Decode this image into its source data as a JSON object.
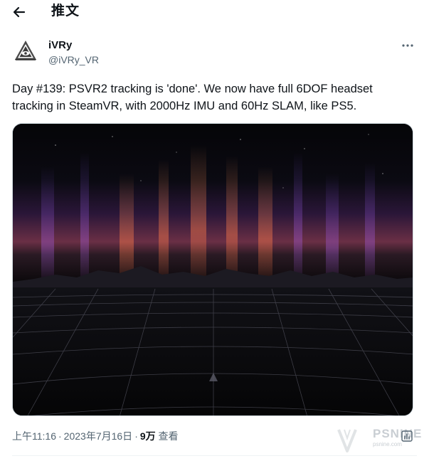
{
  "header": {
    "back_icon": "arrow-left-icon",
    "title": "推文"
  },
  "tweet": {
    "author": {
      "display_name": "iVRy",
      "handle": "@iVRy_VR",
      "avatar_icon": "triangle-eye-logo"
    },
    "more_icon": "more-dots-icon",
    "text": "Day #139: PSVR2 tracking is 'done'. We now have full 6DOF headset tracking in SteamVR, with 2000Hz IMU and 60Hz SLAM, like PS5.",
    "media": {
      "kind": "image",
      "description_icon": "vr-horizon-scene"
    },
    "meta": {
      "time": "上午11:16",
      "separator": "·",
      "date": "2023年7月16日",
      "views_count": "9万",
      "views_label": "查看"
    },
    "stats_icon": "analytics-icon"
  },
  "watermark": {
    "logo_icon": "psnine-logo",
    "text": "PSNINE",
    "subtext": "psnine.com"
  },
  "colors": {
    "text_primary": "#0f1419",
    "text_secondary": "#536471",
    "border": "#cfd9de",
    "divider": "#eff3f4"
  }
}
